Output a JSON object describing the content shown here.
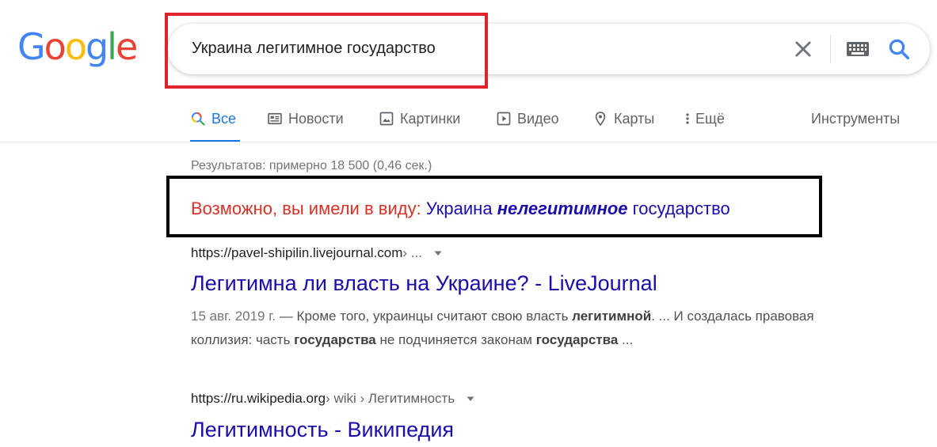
{
  "logo": {
    "letters": [
      "G",
      "o",
      "o",
      "g",
      "l",
      "e"
    ],
    "colors": [
      "#4285F4",
      "#EA4335",
      "#FBBC05",
      "#4285F4",
      "#34A853",
      "#EA4335"
    ]
  },
  "search": {
    "query": "Украина легитимное государство"
  },
  "tabs": [
    {
      "label": "Все",
      "icon": "search-icon",
      "active": true
    },
    {
      "label": "Новости",
      "icon": "news-icon"
    },
    {
      "label": "Картинки",
      "icon": "image-icon"
    },
    {
      "label": "Видео",
      "icon": "video-icon"
    },
    {
      "label": "Карты",
      "icon": "map-pin-icon"
    },
    {
      "label": "Ещё",
      "icon": "more-vert-icon"
    }
  ],
  "tools_label": "Инструменты",
  "stats": "Результатов: примерно 18 500 (0,46 сек.)",
  "did_you_mean": {
    "prefix": "Возможно, вы имели в виду:",
    "part1": "Украина",
    "bold": "нелегитимное",
    "part2": "государство"
  },
  "results": [
    {
      "cite_domain": "https://pavel-shipilin.livejournal.com",
      "cite_path": " › ...",
      "title": "Легитимна ли власть на Украине? - LiveJournal",
      "snippet": {
        "date": "15 авг. 2019 г.",
        "t1": " — Кроме того, украинцы считают свою власть ",
        "b1": "легитимной",
        "t2": ". ... И создалась правовая коллизия: часть ",
        "b2": "государства",
        "t3": " не подчиняется законам ",
        "b3": "государства",
        "t4": " ..."
      }
    },
    {
      "cite_domain": "https://ru.wikipedia.org",
      "cite_path": " › wiki › Легитимность",
      "title": "Легитимность - Википедия"
    }
  ],
  "colors": {
    "link": "#1a0dab",
    "accent": "#1a73e8",
    "did_you_mean": "#d93025",
    "highlight_red": "#e0242d",
    "highlight_black": "#000000"
  }
}
